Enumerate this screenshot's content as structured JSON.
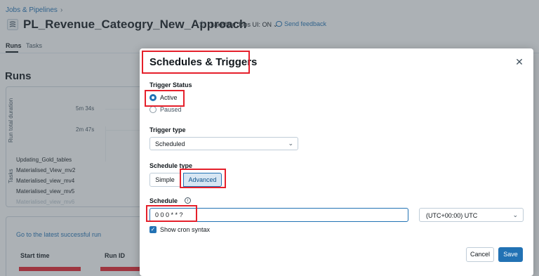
{
  "breadcrumb": {
    "label": "Jobs & Pipelines",
    "separator": "›"
  },
  "header": {
    "job_title": "PL_Revenue_Cateogry_New_Approach",
    "lakeflow_toggle": "Lakeflow Jobs UI: ON",
    "send_feedback": "Send feedback"
  },
  "tabs": [
    {
      "label": "Runs",
      "active": true
    },
    {
      "label": "Tasks",
      "active": false
    }
  ],
  "runs": {
    "heading": "Runs",
    "y_axis_duration": "Run total duration",
    "y_axis_tasks": "Tasks",
    "ticks": [
      "5m 34s",
      "2m 47s"
    ],
    "tasks": [
      "Updating_Gold_tables",
      "Materialised_View_mv2",
      "Materialised_view_mv4",
      "Materialised_view_mv5",
      "Materialised_view_mv6"
    ],
    "latest_link": "Go to the latest successful run",
    "columns": [
      "Start time",
      "Run ID"
    ]
  },
  "modal": {
    "title": "Schedules & Triggers",
    "trigger_status_label": "Trigger Status",
    "status_active": "Active",
    "status_paused": "Paused",
    "trigger_type_label": "Trigger type",
    "trigger_type_value": "Scheduled",
    "schedule_type_label": "Schedule type",
    "schedule_simple": "Simple",
    "schedule_advanced": "Advanced",
    "schedule_label": "Schedule",
    "cron_value": "0 0 0 * * ?",
    "timezone_value": "(UTC+00:00) UTC",
    "show_cron_label": "Show cron syntax",
    "cancel_label": "Cancel",
    "save_label": "Save"
  },
  "colors": {
    "accent": "#2272b4",
    "highlight": "#e5202b"
  }
}
